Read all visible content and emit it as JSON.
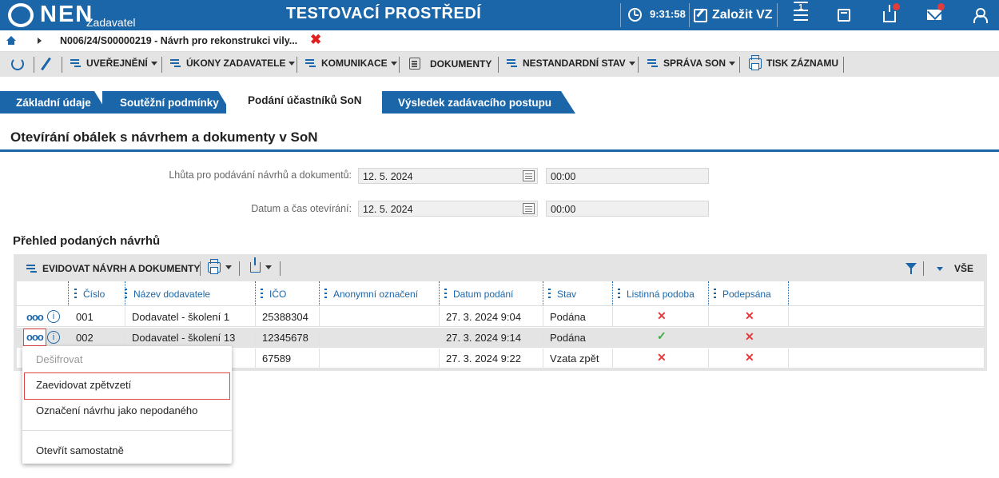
{
  "header": {
    "logo_text": "NEN",
    "logo_sub": "Zadavatel",
    "title": "TESTOVACÍ PROSTŘEDÍ",
    "clock": "9:31:58",
    "new_button_label": "Založit VZ",
    "menu_badge": "1",
    "icons": [
      "clock-icon",
      "edit-icon",
      "menu-icon",
      "calculator-icon",
      "inbox-icon",
      "mail-icon",
      "user-icon"
    ]
  },
  "breadcrumb": {
    "text": "N006/24/S00000219 - Návrh pro rekonstrukci vily...",
    "close": "✖"
  },
  "actions": [
    {
      "label": "UVEŘEJNĚNÍ"
    },
    {
      "label": "ÚKONY ZADAVATELE"
    },
    {
      "label": "KOMUNIKACE"
    },
    {
      "label": "DOKUMENTY"
    },
    {
      "label": "NESTANDARDNÍ STAV"
    },
    {
      "label": "SPRÁVA SON"
    },
    {
      "label": "TISK ZÁZNAMU"
    }
  ],
  "tabs": [
    {
      "label": "Základní údaje"
    },
    {
      "label": "Soutěžní podmínky"
    },
    {
      "label": "Podání účastníků SoN",
      "active": true
    },
    {
      "label": "Výsledek zadávacího postupu"
    }
  ],
  "page_title": "Otevírání obálek s návrhem a dokumenty v SoN",
  "form": {
    "deadline_label": "Lhůta pro podávání návrhů a dokumentů:",
    "deadline_date": "12. 5. 2024",
    "deadline_time": "00:00",
    "opening_label": "Datum a čas otevírání:",
    "opening_date": "12. 5. 2024",
    "opening_time": "00:00"
  },
  "section_title": "Přehled podaných návrhů",
  "grid_toolbar": {
    "record_label": "EVIDOVAT NÁVRH A DOKUMENTY",
    "all_label": "VŠE"
  },
  "columns": [
    "Číslo",
    "Název dodavatele",
    "IČO",
    "Anonymní označení",
    "Datum podání",
    "Stav",
    "Listinná podoba",
    "Podepsána"
  ],
  "rows": [
    {
      "cislo": "001",
      "nazev": "Dodavatel - školení 1",
      "ico": "25388304",
      "anon": "",
      "datum": "27. 3. 2024 9:04",
      "stav": "Podána",
      "listinna": "✕",
      "podepsana": "✕"
    },
    {
      "cislo": "002",
      "nazev": "Dodavatel - školení 13",
      "ico": "12345678",
      "anon": "",
      "datum": "27. 3. 2024 9:14",
      "stav": "Podána",
      "listinna": "✓",
      "podepsana": "✕"
    },
    {
      "cislo": "",
      "nazev": "",
      "ico": "67589",
      "anon": "",
      "datum": "27. 3. 2024 9:22",
      "stav": "Vzata zpět",
      "listinna": "✕",
      "podepsana": "✕"
    }
  ],
  "context_menu": [
    {
      "label": "Dešifrovat",
      "disabled": true
    },
    {
      "label": "Zaevidovat zpětvzetí",
      "highlighted": true
    },
    {
      "label": "Označení návrhu jako nepodaného"
    },
    {
      "label": "Otevřít samostatně"
    }
  ],
  "colors": {
    "brand": "#1b66a9",
    "badge": "#e23b3b",
    "highlight": "#e04545"
  }
}
